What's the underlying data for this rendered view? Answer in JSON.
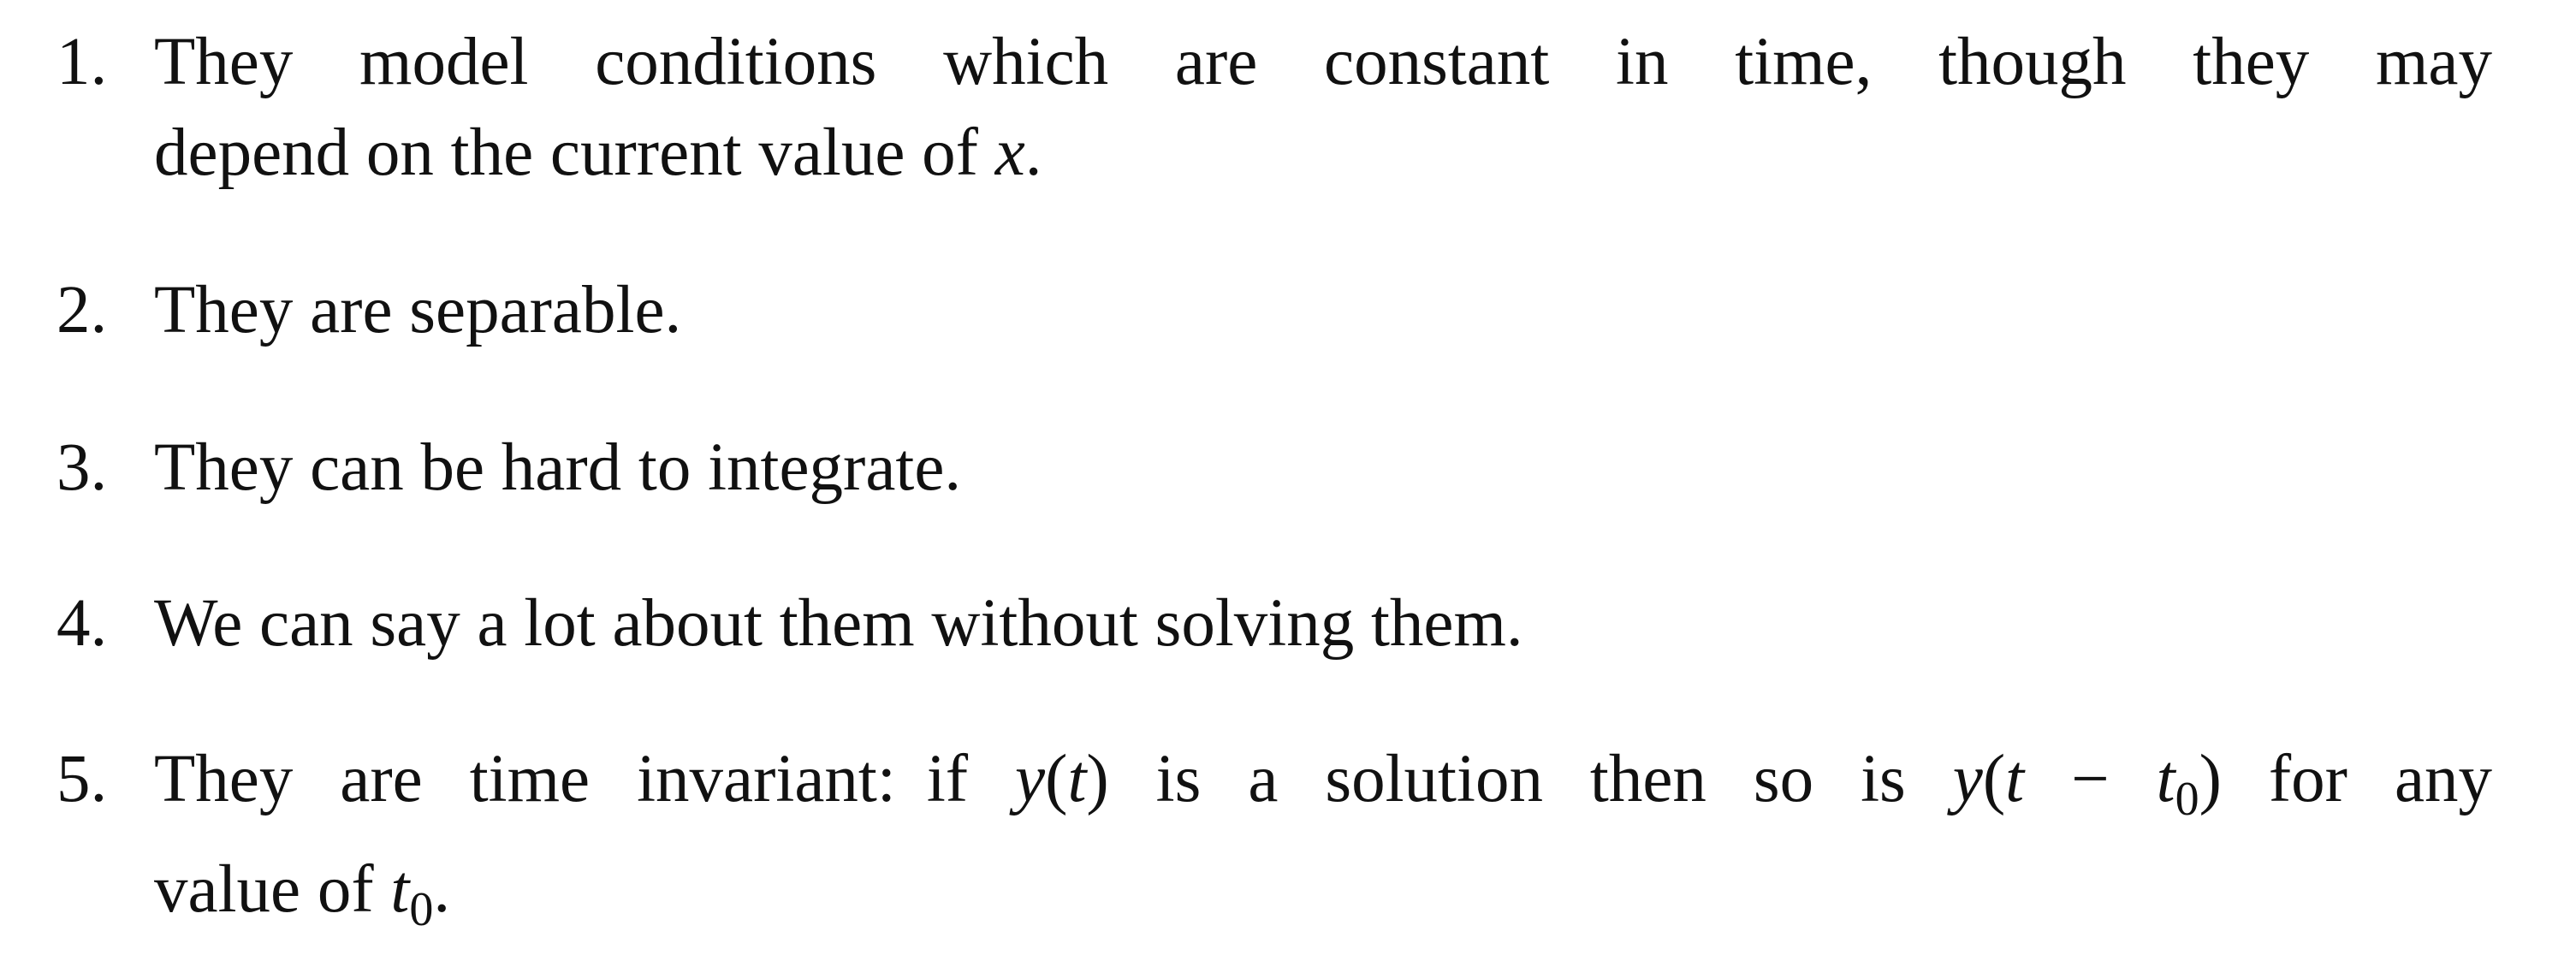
{
  "items": [
    {
      "number": "1.",
      "line1": "They model conditions which are constant in time, though they may",
      "line2_pre": "depend on the current value of ",
      "line2_var": "x",
      "line2_post": "."
    },
    {
      "number": "2.",
      "text": "They are separable."
    },
    {
      "number": "3.",
      "text": "They can be hard to integrate."
    },
    {
      "number": "4.",
      "text": "We can say a lot about them without solving them."
    },
    {
      "number": "5.",
      "pre": "They are time invariant:",
      "if_word": "if ",
      "y1": "y",
      "paren_open": "(",
      "t1": "t",
      "paren_close": ")",
      "mid": " is a solution then so is ",
      "y2": "y",
      "paren_open2": "(",
      "t2": "t",
      "minus": " − ",
      "t0_base": "t",
      "t0_sub": "0",
      "paren_close2": ")",
      "post": " for any",
      "line2_pre": "value of ",
      "line2_t": "t",
      "line2_sub": "0",
      "line2_post": "."
    }
  ]
}
